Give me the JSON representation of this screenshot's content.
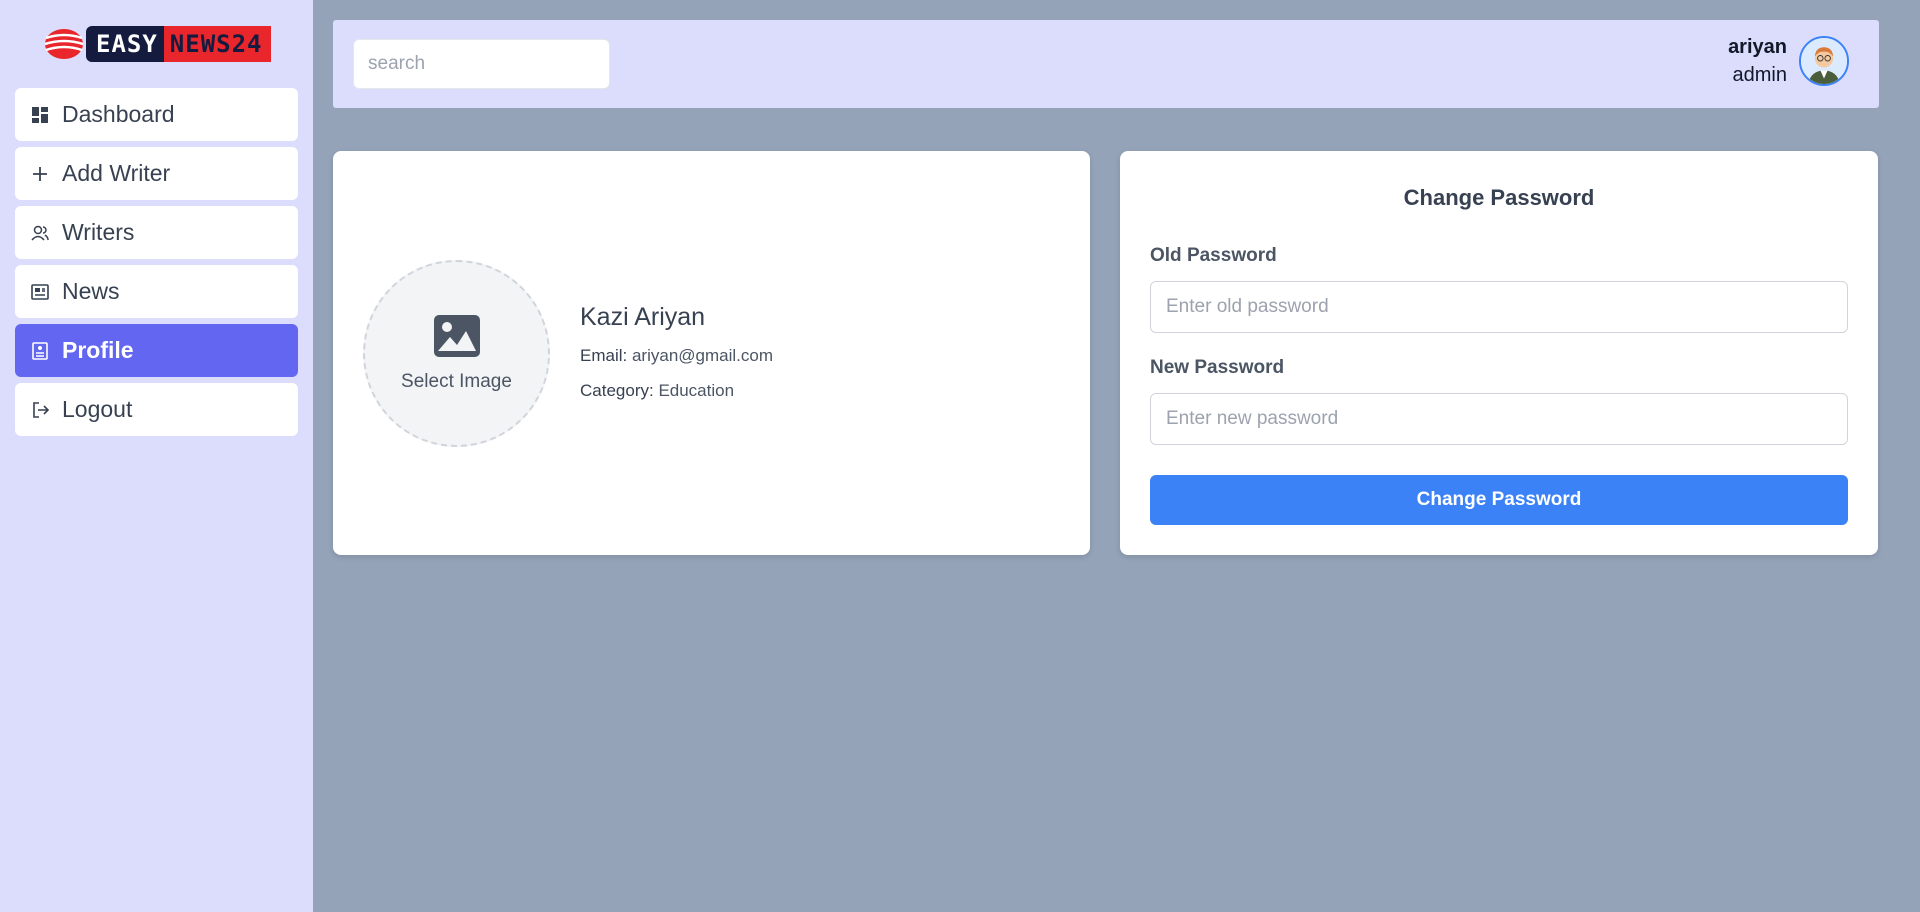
{
  "logo": {
    "part1": "EASY",
    "part2": "NEWS24"
  },
  "sidebar": {
    "items": [
      {
        "label": "Dashboard",
        "icon": "dashboard-icon"
      },
      {
        "label": "Add Writer",
        "icon": "plus-icon"
      },
      {
        "label": "Writers",
        "icon": "users-icon"
      },
      {
        "label": "News",
        "icon": "newspaper-icon"
      },
      {
        "label": "Profile",
        "icon": "profile-icon",
        "active": true
      },
      {
        "label": "Logout",
        "icon": "logout-icon"
      }
    ]
  },
  "header": {
    "search_placeholder": "search",
    "user_name": "ariyan",
    "user_role": "admin"
  },
  "profile": {
    "select_image_label": "Select Image",
    "name": "Kazi Ariyan",
    "email_label": "Email:",
    "email_value": "ariyan@gmail.com",
    "category_label": "Category:",
    "category_value": "Education"
  },
  "password": {
    "title": "Change Password",
    "old_label": "Old Password",
    "old_placeholder": "Enter old password",
    "new_label": "New Password",
    "new_placeholder": "Enter new password",
    "button_label": "Change Password"
  },
  "colors": {
    "sidebar_bg": "#dcdcfc",
    "page_bg": "#94a3b8",
    "active_nav": "#6366f1",
    "primary_button": "#3b82f6"
  }
}
